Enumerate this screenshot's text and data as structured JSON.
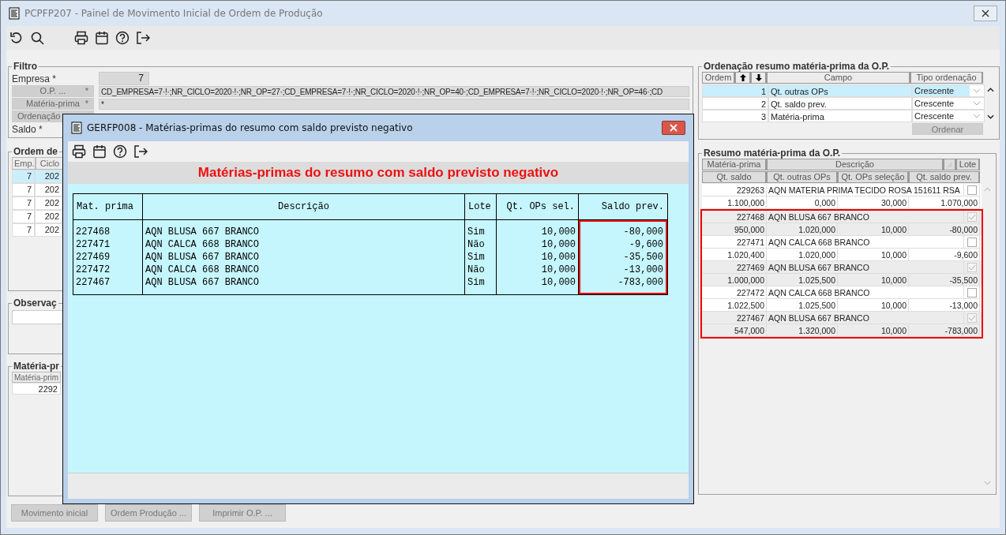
{
  "window": {
    "title": "PCPFP207 - Painel de Movimento Inicial de Ordem de Produção"
  },
  "filter": {
    "title": "Filtro",
    "fields": [
      {
        "kind": "label",
        "label": "Empresa *",
        "value": "7"
      },
      {
        "kind": "button",
        "label": "O.P. ...",
        "mark": "*",
        "value": "CD_EMPRESA=7·!·;NR_CICLO=2020·!·;NR_OP=27·;CD_EMPRESA=7·!·;NR_CICLO=2020·!·;NR_OP=40·;CD_EMPRESA=7·!·;NR_CICLO=2020·!·;NR_OP=46·;CD"
      },
      {
        "kind": "button",
        "label": "Matéria-prima",
        "mark": "*",
        "value": "*"
      },
      {
        "kind": "button",
        "label": "Ordenação"
      },
      {
        "kind": "label",
        "label": "Saldo *"
      }
    ]
  },
  "orders": {
    "title": "Ordem de",
    "columns": [
      "Emp.",
      "Ciclo"
    ],
    "rows": [
      {
        "cells": [
          "7",
          "202"
        ],
        "selected": true
      },
      {
        "cells": [
          "7",
          "202"
        ],
        "selected": false
      },
      {
        "cells": [
          "7",
          "202"
        ],
        "selected": false
      },
      {
        "cells": [
          "7",
          "202"
        ],
        "selected": false
      },
      {
        "cells": [
          "7",
          "202"
        ],
        "selected": false
      }
    ]
  },
  "notes": {
    "title": "Observaç"
  },
  "materials": {
    "title": "Matéria-pr",
    "columns": [
      "Matéria-prim"
    ],
    "rows": [
      [
        "2292"
      ]
    ]
  },
  "buttons": [
    {
      "label": "Movimento inicial",
      "disabled": true
    },
    {
      "label": "Ordem Produção ...",
      "disabled": true
    },
    {
      "label": "Imprimir O.P. ...",
      "disabled": true
    }
  ],
  "sort_panel": {
    "title": "Ordenação resumo matéria-prima da O.P.",
    "columns": [
      "Ordem",
      "Campo",
      "Tipo ordenação"
    ],
    "rows": [
      {
        "order": "1",
        "field": "Qt. outras OPs",
        "type": "Crescente",
        "selected": true
      },
      {
        "order": "2",
        "field": "Qt. saldo prev.",
        "type": "Crescente",
        "selected": false
      },
      {
        "order": "3",
        "field": "Matéria-prima",
        "type": "Crescente",
        "selected": false
      }
    ],
    "button": {
      "label": "Ordenar",
      "disabled": true
    }
  },
  "summary": {
    "title": "Resumo matéria-prima da O.P.",
    "header_top": [
      "Matéria-prima",
      "Descrição",
      "Lote"
    ],
    "header_bottom": [
      "Qt. saldo",
      "Qt. outras OPs",
      "Qt. OPs seleção",
      "Qt. saldo prev."
    ],
    "records": [
      {
        "code": "229263",
        "description": "AQN MATERIA PRIMA TECIDO ROSA 151611 RSA",
        "checked": false,
        "values": [
          "1.100,000",
          "0,000",
          "30,000",
          "1.070,000"
        ],
        "highlighted": false
      },
      {
        "code": "227468",
        "description": "AQN BLUSA 667 BRANCO",
        "checked": true,
        "values": [
          "950,000",
          "1.020,000",
          "10,000",
          "-80,000"
        ],
        "highlighted": true
      },
      {
        "code": "227471",
        "description": "AQN CALCA 668 BRANCO",
        "checked": false,
        "values": [
          "1.020,400",
          "1.020,000",
          "10,000",
          "-9,600"
        ],
        "highlighted": true
      },
      {
        "code": "227469",
        "description": "AQN BLUSA 667 BRANCO",
        "checked": true,
        "values": [
          "1.000,000",
          "1.025,500",
          "10,000",
          "-35,500"
        ],
        "highlighted": true
      },
      {
        "code": "227472",
        "description": "AQN CALCA 668 BRANCO",
        "checked": false,
        "values": [
          "1.022,500",
          "1.025,500",
          "10,000",
          "-13,000"
        ],
        "highlighted": true
      },
      {
        "code": "227467",
        "description": "AQN BLUSA 667 BRANCO",
        "checked": true,
        "values": [
          "547,000",
          "1.320,000",
          "10,000",
          "-783,000"
        ],
        "highlighted": true
      }
    ]
  },
  "dialog": {
    "title": "GERFP008 - Matérias-primas do resumo com saldo previsto negativo",
    "heading": "Matérias-primas do resumo com saldo previsto negativo",
    "columns": [
      {
        "label": "Mat. prima",
        "highlighted": false
      },
      {
        "label": "Descrição",
        "highlighted": false
      },
      {
        "label": "Lote",
        "highlighted": false
      },
      {
        "label": "Qt. OPs sel.",
        "highlighted": false
      },
      {
        "label": "Saldo prev.",
        "highlighted": true
      }
    ],
    "rows": [
      [
        "227468",
        "AQN BLUSA 667 BRANCO",
        "Sim",
        "10,000",
        "-80,000"
      ],
      [
        "227471",
        "AQN CALCA 668 BRANCO",
        "Não",
        "10,000",
        "-9,600"
      ],
      [
        "227469",
        "AQN BLUSA 667 BRANCO",
        "Sim",
        "10,000",
        "-35,500"
      ],
      [
        "227472",
        "AQN CALCA 668 BRANCO",
        "Não",
        "10,000",
        "-13,000"
      ],
      [
        "227467",
        "AQN BLUSA 667 BRANCO",
        "Sim",
        "10,000",
        "-783,000"
      ]
    ]
  }
}
